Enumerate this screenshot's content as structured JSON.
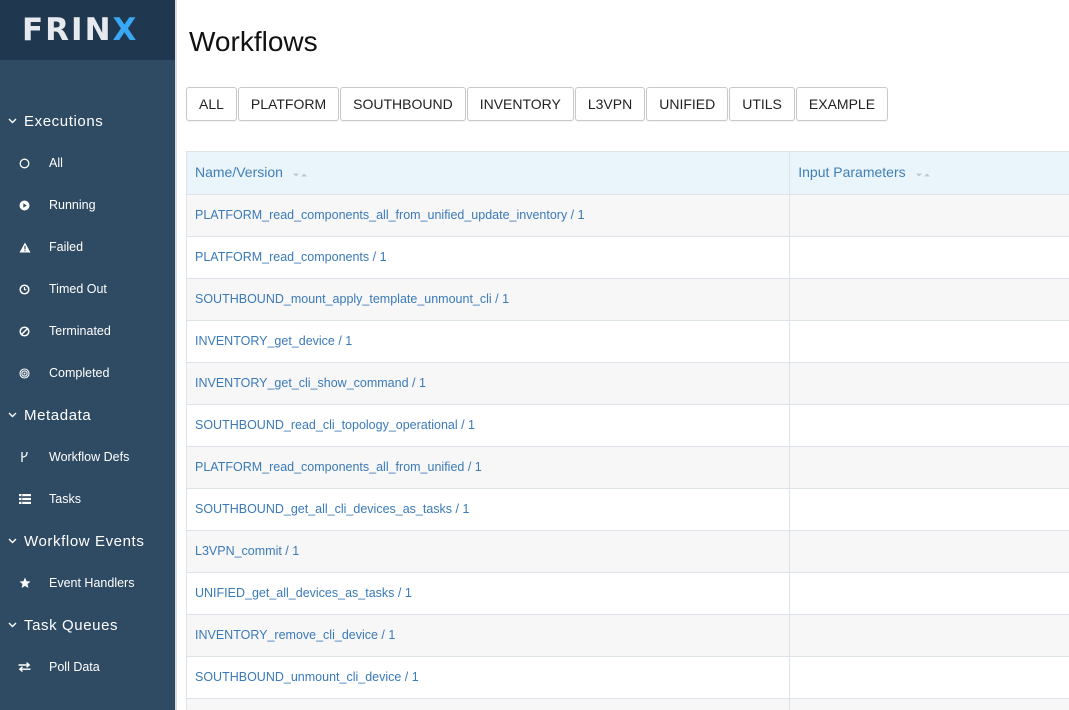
{
  "brand": {
    "logo_main": "FRIN",
    "logo_accent": "X"
  },
  "colors": {
    "sidebar_bg": "#2f4a63",
    "logo_bg": "#1f3850",
    "accent": "#39a8f2",
    "link": "#3a7ab8",
    "header_bg": "#eaf4fb"
  },
  "sidebar": {
    "sections": [
      {
        "title": "Executions",
        "items": [
          {
            "label": "All",
            "icon": "circle-outline-icon"
          },
          {
            "label": "Running",
            "icon": "play-circle-icon"
          },
          {
            "label": "Failed",
            "icon": "warning-icon"
          },
          {
            "label": "Timed Out",
            "icon": "clock-icon"
          },
          {
            "label": "Terminated",
            "icon": "ban-icon"
          },
          {
            "label": "Completed",
            "icon": "bullseye-icon"
          }
        ]
      },
      {
        "title": "Metadata",
        "items": [
          {
            "label": "Workflow Defs",
            "icon": "fork-icon"
          },
          {
            "label": "Tasks",
            "icon": "tasks-icon"
          }
        ]
      },
      {
        "title": "Workflow Events",
        "items": [
          {
            "label": "Event Handlers",
            "icon": "star-icon"
          }
        ]
      },
      {
        "title": "Task Queues",
        "items": [
          {
            "label": "Poll Data",
            "icon": "exchange-icon"
          }
        ]
      }
    ]
  },
  "main": {
    "title": "Workflows",
    "tabs": [
      "ALL",
      "PLATFORM",
      "SOUTHBOUND",
      "INVENTORY",
      "L3VPN",
      "UNIFIED",
      "UTILS",
      "EXAMPLE"
    ],
    "table": {
      "columns": [
        "Name/Version",
        "Input Parameters"
      ],
      "rows": [
        "PLATFORM_read_components_all_from_unified_update_inventory / 1",
        "PLATFORM_read_components / 1",
        "SOUTHBOUND_mount_apply_template_unmount_cli / 1",
        "INVENTORY_get_device / 1",
        "INVENTORY_get_cli_show_command / 1",
        "SOUTHBOUND_read_cli_topology_operational / 1",
        "PLATFORM_read_components_all_from_unified / 1",
        "SOUTHBOUND_get_all_cli_devices_as_tasks / 1",
        "L3VPN_commit / 1",
        "UNIFIED_get_all_devices_as_tasks / 1",
        "INVENTORY_remove_cli_device / 1",
        "SOUTHBOUND_unmount_cli_device / 1",
        ""
      ]
    }
  }
}
